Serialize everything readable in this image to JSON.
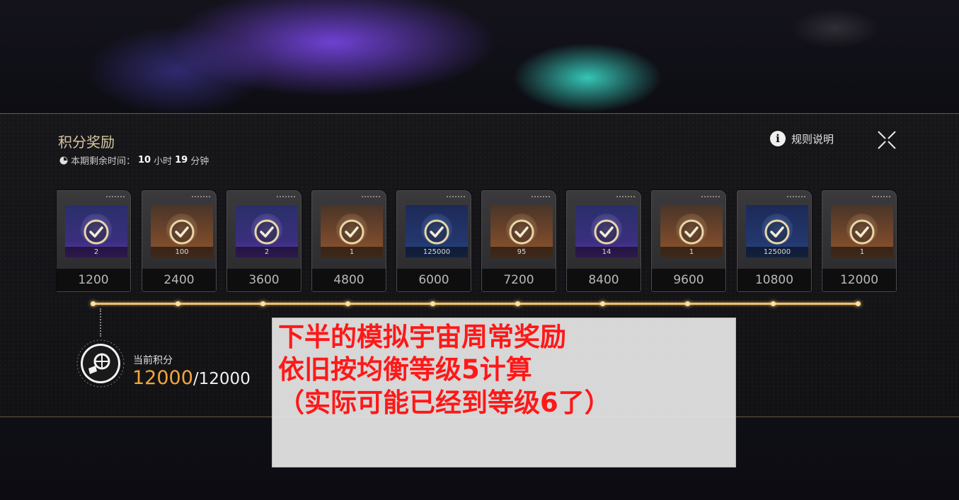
{
  "panel": {
    "title": "积分奖励",
    "timer_prefix": "本期剩余时间：",
    "timer_hours": "10",
    "timer_hours_unit": "小时",
    "timer_minutes": "19",
    "timer_minutes_unit": "分钟",
    "rules_label": "规则说明"
  },
  "rewards": [
    {
      "points": "1200",
      "qty": "2",
      "color": "purple",
      "claimed": true
    },
    {
      "points": "2400",
      "qty": "100",
      "color": "orange",
      "claimed": true
    },
    {
      "points": "3600",
      "qty": "2",
      "color": "purple",
      "claimed": true
    },
    {
      "points": "4800",
      "qty": "1",
      "color": "orange",
      "claimed": true
    },
    {
      "points": "6000",
      "qty": "125000",
      "color": "blue",
      "claimed": true
    },
    {
      "points": "7200",
      "qty": "95",
      "color": "orange",
      "claimed": true
    },
    {
      "points": "8400",
      "qty": "14",
      "color": "purple",
      "claimed": true
    },
    {
      "points": "9600",
      "qty": "1",
      "color": "orange",
      "claimed": true
    },
    {
      "points": "10800",
      "qty": "125000",
      "color": "blue",
      "claimed": true
    },
    {
      "points": "12000",
      "qty": "1",
      "color": "orange",
      "claimed": true
    }
  ],
  "score": {
    "label": "当前积分",
    "current": "12000",
    "total": "/12000",
    "progress_fraction": 1.0
  },
  "caption": {
    "line1": "下半的模拟宇宙周常奖励",
    "line2": "依旧按均衡等级5计算",
    "line3": "（实际可能已经到等级6了）"
  },
  "colors": {
    "accent": "#f2a53a",
    "caption_text": "#ff1818",
    "title": "#d8c6a0"
  },
  "icons": {
    "close": "close-icon",
    "info": "info-icon",
    "clock": "clock-icon",
    "check": "check-icon"
  }
}
